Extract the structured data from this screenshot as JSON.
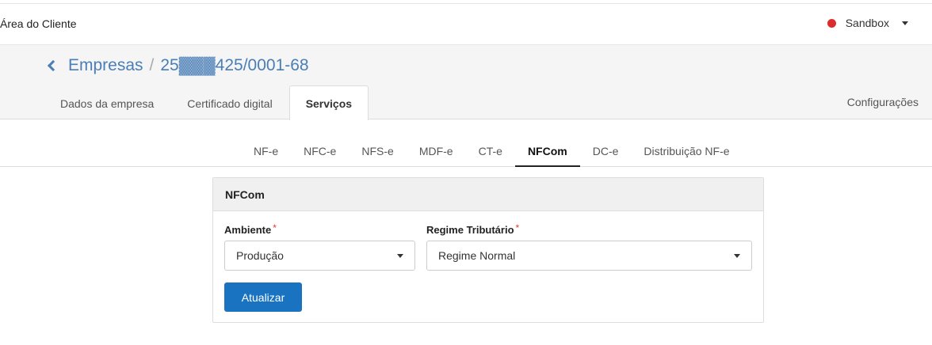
{
  "topbar": {
    "title": "Área do Cliente",
    "environment": "Sandbox",
    "environment_color": "#dd2c2c"
  },
  "breadcrumb": {
    "parent": "Empresas",
    "separator": "/",
    "current": "25▓▓▓425/0001-68"
  },
  "main_tabs": [
    {
      "label": "Dados da empresa"
    },
    {
      "label": "Certificado digital"
    },
    {
      "label": "Serviços"
    }
  ],
  "settings_label": "Configurações",
  "service_tabs": [
    {
      "label": "NF-e"
    },
    {
      "label": "NFC-e"
    },
    {
      "label": "NFS-e"
    },
    {
      "label": "MDF-e"
    },
    {
      "label": "CT-e"
    },
    {
      "label": "NFCom"
    },
    {
      "label": "DC-e"
    },
    {
      "label": "Distribuição NF-e"
    }
  ],
  "panel": {
    "title": "NFCom",
    "ambiente": {
      "label": "Ambiente",
      "required_mark": "*",
      "value": "Produção"
    },
    "regime": {
      "label": "Regime Tributário",
      "required_mark": "*",
      "value": "Regime Normal"
    },
    "submit_label": "Atualizar"
  },
  "colors": {
    "accent": "#1a73c0",
    "link": "#4a7eb6"
  }
}
